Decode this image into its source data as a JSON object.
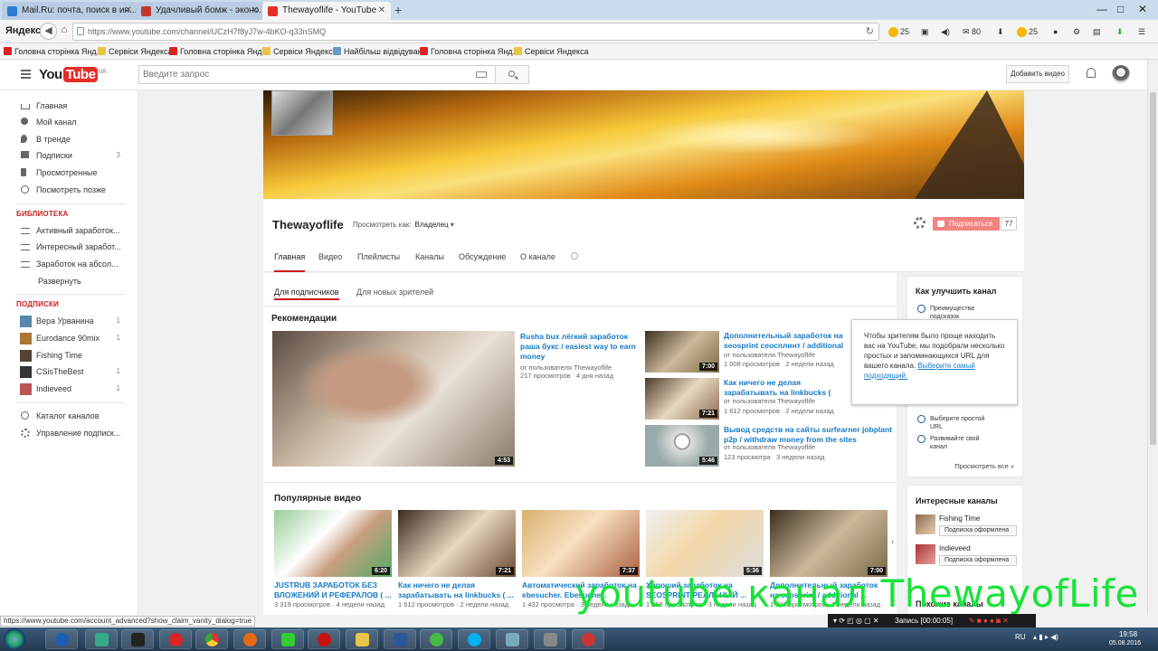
{
  "browser": {
    "tabs": [
      {
        "title": "Mail.Ru: почта, поиск в ин...",
        "color": "#2a7bd1"
      },
      {
        "title": "Удачливый бомж - эконо...",
        "color": "#c0392b"
      },
      {
        "title": "Thewayoflife - YouTube",
        "color": "#e52d27"
      }
    ],
    "new_tab": "+",
    "win_controls": [
      "—",
      "□",
      "✕"
    ],
    "brand": "Яндекс",
    "url": "https://www.youtube.com/channel/UCzH7f8yJ7w-4bKO-q33nSMQ",
    "ext_counts": [
      "25",
      "80",
      "25"
    ],
    "bookmarks": [
      "Головна сторінка Янд...",
      "Сервіси Яндекса",
      "Головна сторінка Янд...",
      "Сервіси Яндекса",
      "Найбільш відвідувані",
      "Головна сторінка Янд...",
      "Сервіси Яндекса"
    ]
  },
  "header": {
    "logo_you": "You",
    "logo_tube": "Tube",
    "logo_region": "UA",
    "search_placeholder": "Введите запрос",
    "upload_label": "Добавить видео"
  },
  "sidebar": {
    "items": [
      {
        "label": "Главная",
        "icon": "home-icon"
      },
      {
        "label": "Мой канал",
        "icon": "user-icon"
      },
      {
        "label": "В тренде",
        "icon": "flame-icon"
      },
      {
        "label": "Подписки",
        "icon": "subscriptions-icon",
        "count": "3"
      },
      {
        "label": "Просмотренные",
        "icon": "history-icon"
      },
      {
        "label": "Посмотреть позже",
        "icon": "clock-icon"
      }
    ],
    "library_title": "БИБЛИОТЕКА",
    "library": [
      "Активный заработок...",
      "Интересный заработ...",
      "Заработок на абсол..."
    ],
    "expand_label": "Развернуть",
    "subs_title": "ПОДПИСКИ",
    "subs": [
      {
        "label": "Вера Урванина",
        "count": "1",
        "color": "#58a"
      },
      {
        "label": "Eurodance 90mix",
        "count": "1",
        "color": "#a73"
      },
      {
        "label": "Fishing Time",
        "count": "",
        "color": "#543"
      },
      {
        "label": "CSisTheBest",
        "count": "1",
        "color": "#333"
      },
      {
        "label": "Indieveed",
        "count": "1",
        "color": "#b55"
      }
    ],
    "bottom": [
      {
        "label": "Каталог каналов",
        "icon": "plus-circle-icon"
      },
      {
        "label": "Управление подписк...",
        "icon": "gear-icon"
      }
    ]
  },
  "channel": {
    "name": "Thewayoflife",
    "view_as_label": "Просмотреть как:",
    "view_as_value": "Владелец",
    "subscribe_label": "Подписаться",
    "subscriber_count": "77",
    "tabs": [
      "Главная",
      "Видео",
      "Плейлисты",
      "Каналы",
      "Обсуждение",
      "О канале"
    ]
  },
  "content": {
    "subtabs": [
      "Для подписчиков",
      "Для новых зрителей"
    ],
    "recommend_title": "Рекомендации",
    "featured": {
      "title": "Rusha bux лёгкий заработок раша букс / easiest way to earn money",
      "author": "от пользователя Thewayoflife",
      "views": "217 просмотров",
      "age": "4 дня назад",
      "duration": "4:53"
    },
    "side_videos": [
      {
        "title": "Дополнительный заработок на seosprint сеосплинт / additional earning in internet",
        "author": "от пользователя Thewayoflife",
        "views": "1 008 просмотров",
        "age": "2 недели назад",
        "duration": "7:00"
      },
      {
        "title": "Как ничего не делая зарабатывать на linkbucks ( линкбакс ) / how to earn",
        "author": "от пользователя Thewayoflife",
        "views": "1 612 просмотров",
        "age": "2 недели назад",
        "duration": "7:21"
      },
      {
        "title": "Вывод средств на сайты surfearner jobplant p2p / withdraw money from the sites",
        "author": "от пользователя Thewayoflife",
        "views": "123 просмотра",
        "age": "3 недели назад",
        "duration": "5:46"
      }
    ],
    "popular_title": "Популярные видео",
    "popular": [
      {
        "title": "JUSTRUB ЗАРАБОТОК БЕЗ ВЛОЖЕНИЙ И РЕФЕРАЛОВ ( ...",
        "views": "3 319 просмотров",
        "age": "4 недели назад",
        "duration": "6:20"
      },
      {
        "title": "Как ничего не делая зарабатывать на linkbucks ( ...",
        "views": "1 612 просмотров",
        "age": "2 недели назад",
        "duration": "7:21"
      },
      {
        "title": "Автоматический заработок на ebesucher. Ebesuche...",
        "views": "1 432 просмотра",
        "age": "3 недели назад",
        "duration": "7:37"
      },
      {
        "title": "Хороший заработок на SEOSPRINT РЕАЛЬНЫЙ ...",
        "views": "1 268 просмотров",
        "age": "3 недели назад",
        "duration": "5:36"
      },
      {
        "title": "Дополнительный заработок на seosprint / additional ...",
        "views": "1 008 просмотров",
        "age": "2 недели назад",
        "duration": "7:00"
      }
    ]
  },
  "improve": {
    "title": "Как улучшить канал",
    "options": [
      "Преимущества подсказок",
      "Выберите простой URL",
      "Развивайте свой канал"
    ],
    "view_all": "Просмотреть все »"
  },
  "tooltip": {
    "text": "Чтобы зрителям было проще находить вас на YouTube, мы подобрали несколько простых и запоминающихся URL для вашего канала.",
    "link": "Выберите самый подходящий."
  },
  "interesting": {
    "title": "Интересные каналы",
    "channels": [
      {
        "name": "Fishing Time",
        "button": "Подписка оформлена"
      },
      {
        "name": "Indieveed",
        "button": "Подписка оформлена"
      }
    ],
    "next_title": "Похожие каналы"
  },
  "status_url": "https://www.youtube.com/account_advanced?show_claim_vanity_dialog=true",
  "watermark": "youtube  канал  ThewayofLife",
  "recorder": {
    "label": "Запись [00:00:05]"
  },
  "taskbar": {
    "lang": "RU",
    "time": "19:58",
    "date": "05.08.2016"
  }
}
